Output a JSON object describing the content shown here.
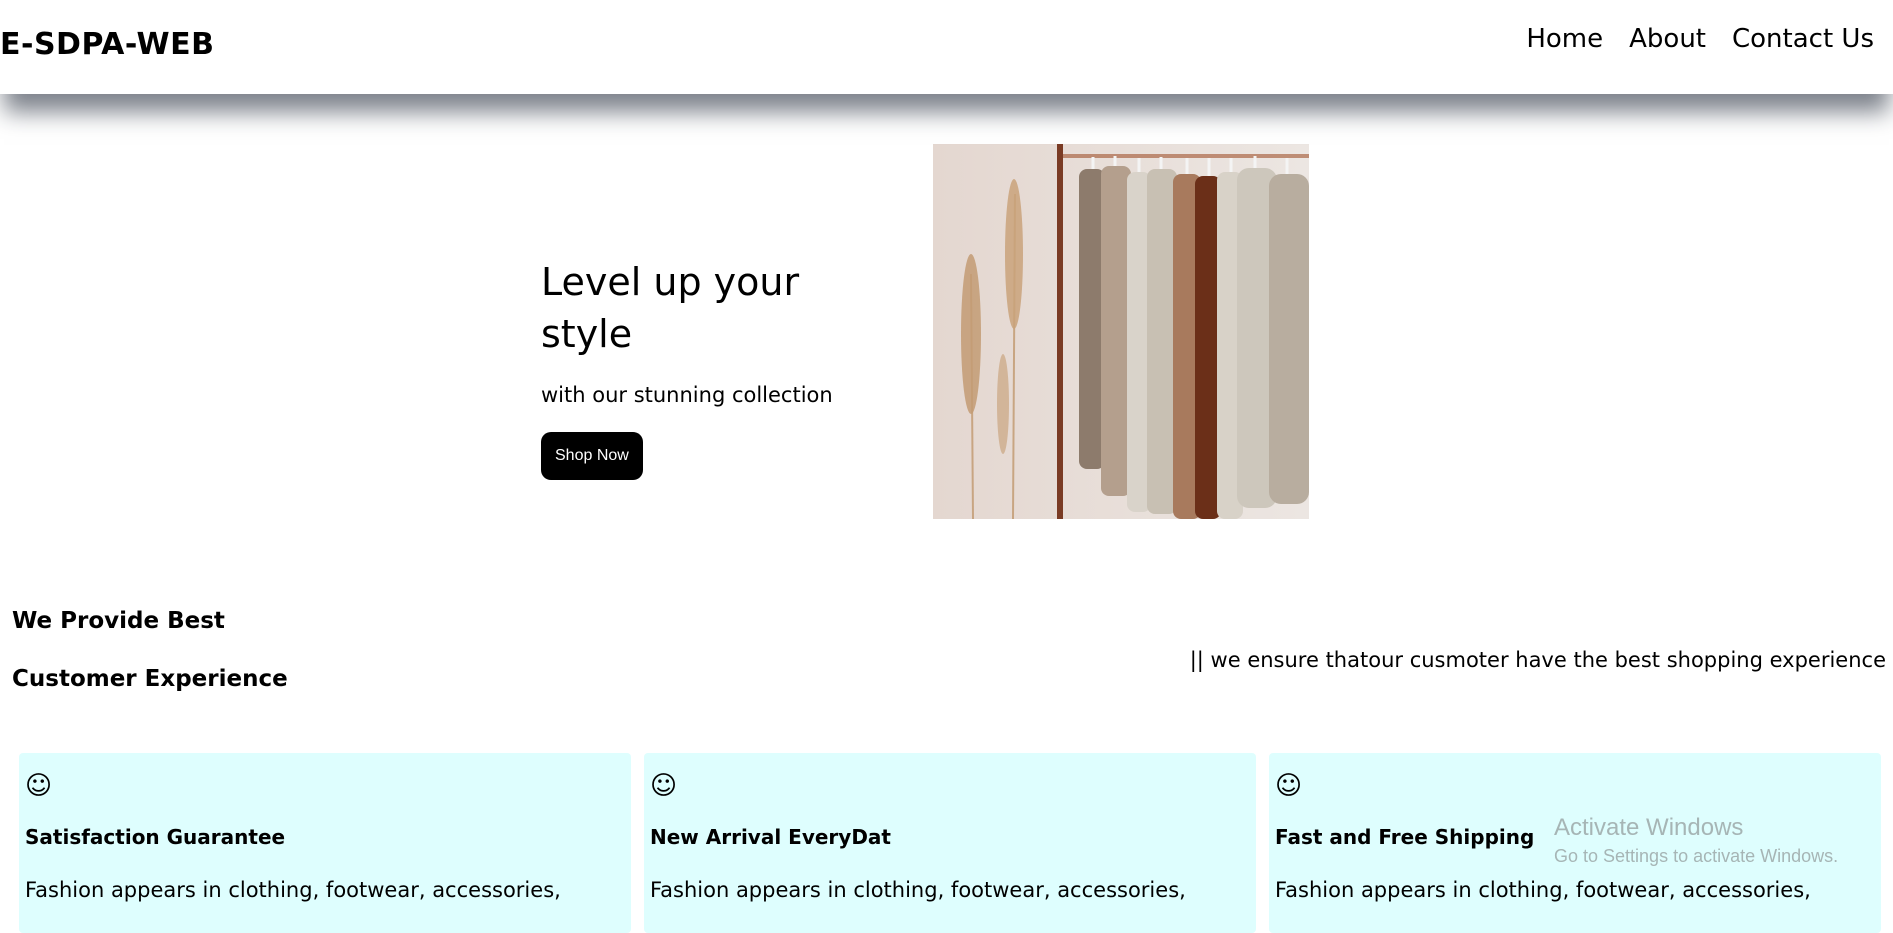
{
  "header": {
    "logo": "E-SDPA-WEB",
    "nav": [
      "Home",
      "About",
      "Contact Us"
    ]
  },
  "hero": {
    "title": "Level up your style",
    "subtitle": "with our stunning collection",
    "button_label": "Shop Now",
    "image_name": "clothing-rack-photo"
  },
  "experience": {
    "heading_line1": "We Provide Best",
    "heading_line2": "Customer Experience",
    "tagline": "|| we ensure thatour cusmoter have the best shopping experience"
  },
  "cards": [
    {
      "icon": "☺",
      "icon_name": "smiley-icon",
      "title": "Satisfaction Guarantee",
      "text": "Fashion appears in clothing, footwear, accessories,"
    },
    {
      "icon": "☺",
      "icon_name": "smiley-icon",
      "title": "New Arrival EveryDat",
      "text": "Fashion appears in clothing, footwear, accessories,"
    },
    {
      "icon": "☺",
      "icon_name": "smiley-icon",
      "title": "Fast and Free Shipping",
      "text": "Fashion appears in clothing, footwear, accessories,"
    }
  ],
  "watermark": {
    "title": "Activate Windows",
    "subtitle": "Go to Settings to activate Windows."
  },
  "colors": {
    "card_background": "#defefe",
    "button_background": "#000000",
    "button_text": "#ffffff"
  }
}
